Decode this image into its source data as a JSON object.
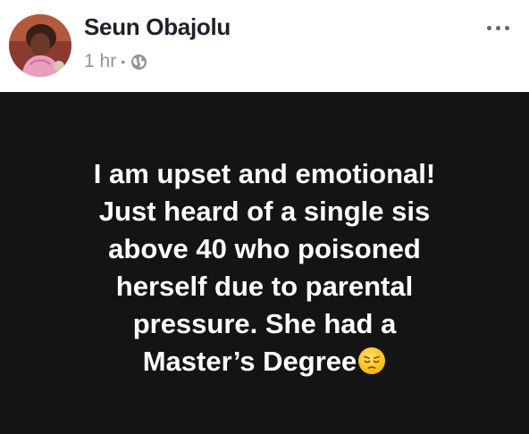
{
  "post": {
    "author": "Seun Obajolu",
    "time": "1 hr",
    "separator": "•",
    "privacy_icon": "globe-icon",
    "more_icon": "more-options-icon",
    "status_background": "#141414",
    "status_lines": [
      "I am upset and emotional!",
      "Just heard of a single sis",
      "above 40 who poisoned",
      "herself due to parental",
      "pressure.  She had a",
      "Master’s Degree"
    ],
    "emoji_icon": "pensive-face-emoji"
  }
}
